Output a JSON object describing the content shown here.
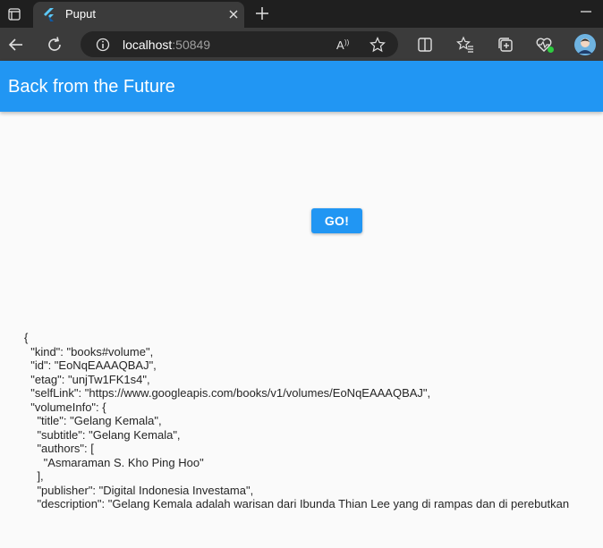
{
  "browser": {
    "tab_title": "Puput",
    "url_host": "localhost",
    "url_port": ":50849"
  },
  "app": {
    "title": "Back from the Future",
    "go_label": "GO!"
  },
  "result_lines": [
    "{",
    "  \"kind\": \"books#volume\",",
    "  \"id\": \"EoNqEAAAQBAJ\",",
    "  \"etag\": \"unjTw1FK1s4\",",
    "  \"selfLink\": \"https://www.googleapis.com/books/v1/volumes/EoNqEAAAQBAJ\",",
    "  \"volumeInfo\": {",
    "    \"title\": \"Gelang Kemala\",",
    "    \"subtitle\": \"Gelang Kemala\",",
    "    \"authors\": [",
    "      \"Asmaraman S. Kho Ping Hoo\"",
    "    ],",
    "    \"publisher\": \"Digital Indonesia Investama\",",
    "    \"description\": \"Gelang Kemala adalah warisan dari Ibunda Thian Lee yang di rampas dan di perebutkan"
  ],
  "colors": {
    "appbar": "#2196f3",
    "tabstrip": "#1f1f1f",
    "toolbar": "#3b3b3b"
  }
}
